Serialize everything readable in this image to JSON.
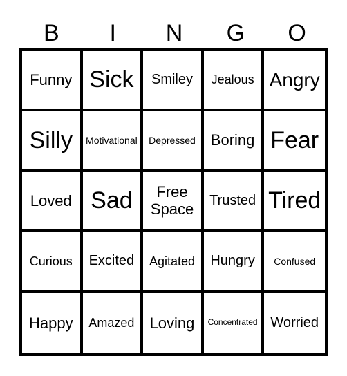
{
  "header": [
    "B",
    "I",
    "N",
    "G",
    "O"
  ],
  "cells": [
    [
      {
        "text": "Funny",
        "size": "m"
      },
      {
        "text": "Sick",
        "size": "xl"
      },
      {
        "text": "Smiley",
        "size": "ms"
      },
      {
        "text": "Jealous",
        "size": "s"
      },
      {
        "text": "Angry",
        "size": "l"
      }
    ],
    [
      {
        "text": "Silly",
        "size": "xl"
      },
      {
        "text": "Motivational",
        "size": "xs"
      },
      {
        "text": "Depressed",
        "size": "xs"
      },
      {
        "text": "Boring",
        "size": "m"
      },
      {
        "text": "Fear",
        "size": "xl"
      }
    ],
    [
      {
        "text": "Loved",
        "size": "m"
      },
      {
        "text": "Sad",
        "size": "xl"
      },
      {
        "text": "Free Space",
        "size": "m"
      },
      {
        "text": "Trusted",
        "size": "ms"
      },
      {
        "text": "Tired",
        "size": "xl"
      }
    ],
    [
      {
        "text": "Curious",
        "size": "s"
      },
      {
        "text": "Excited",
        "size": "ms"
      },
      {
        "text": "Agitated",
        "size": "s"
      },
      {
        "text": "Hungry",
        "size": "ms"
      },
      {
        "text": "Confused",
        "size": "xs"
      }
    ],
    [
      {
        "text": "Happy",
        "size": "m"
      },
      {
        "text": "Amazed",
        "size": "s"
      },
      {
        "text": "Loving",
        "size": "m"
      },
      {
        "text": "Concentrated",
        "size": "xxs"
      },
      {
        "text": "Worried",
        "size": "ms"
      }
    ]
  ]
}
